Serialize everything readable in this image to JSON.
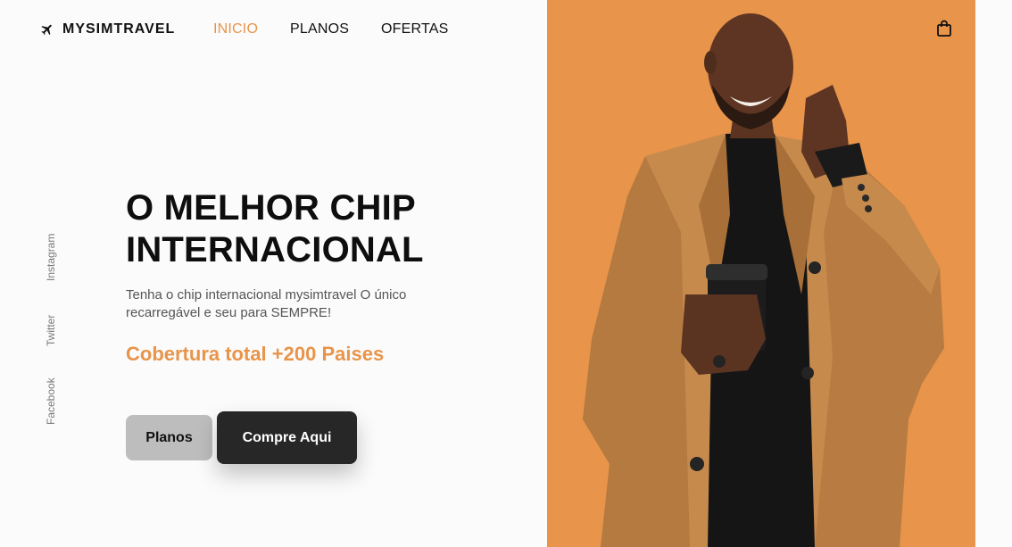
{
  "brand": {
    "name": "MYSIMTRAVEL",
    "icon": "airplane-icon"
  },
  "nav": {
    "items": [
      {
        "label": "INICIO",
        "active": true
      },
      {
        "label": "PLANOS",
        "active": false
      },
      {
        "label": "OFERTAS",
        "active": false
      }
    ]
  },
  "cart": {
    "icon": "shopping-bag-icon"
  },
  "social": {
    "items": [
      "Instagram",
      "Twitter",
      "Facebook"
    ]
  },
  "hero": {
    "title_line1": "O MELHOR CHIP",
    "title_line2": "INTERNACIONAL",
    "description": "Tenha o chip internacional mysimtravel O único recarregável e seu para SEMPRE!",
    "coverage": "Cobertura total +200 Paises",
    "buttons": {
      "planos": "Planos",
      "compre": "Compre Aqui"
    }
  },
  "colors": {
    "accent": "#e8944a",
    "dark_button": "#272727",
    "light_button": "#bdbdbd",
    "background": "#fbfbfb"
  }
}
